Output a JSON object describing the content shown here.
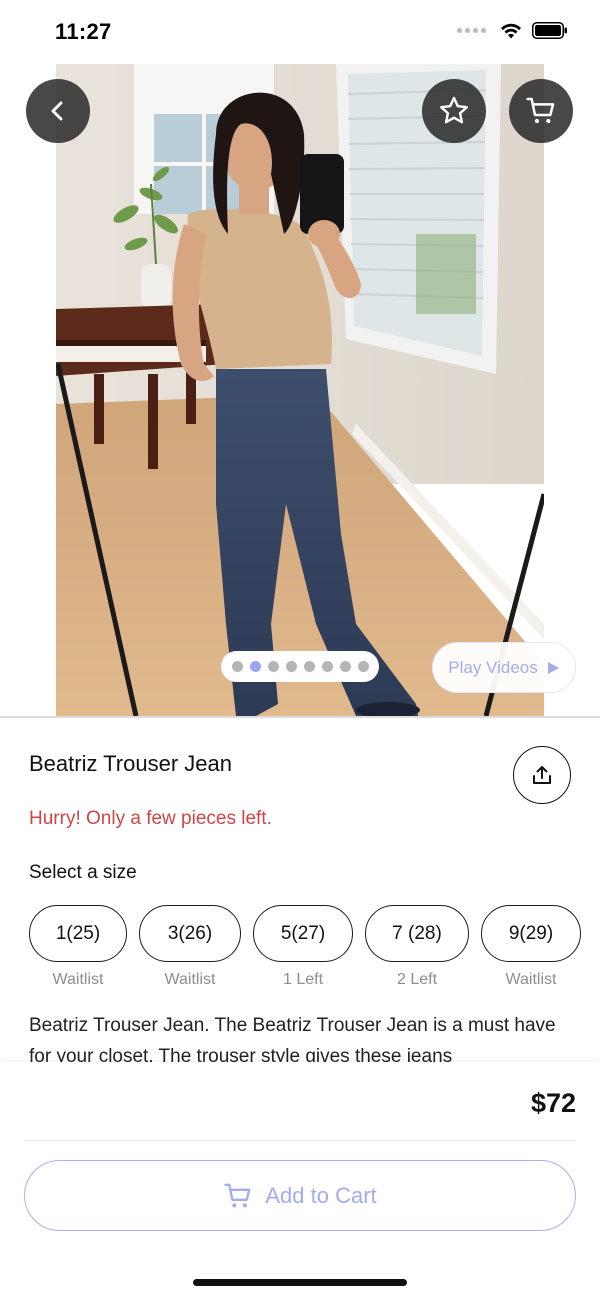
{
  "status_bar": {
    "time": "11:27"
  },
  "hero": {
    "pager_count": 8,
    "pager_active_index": 1,
    "play_videos_label": "Play Videos"
  },
  "product": {
    "title": "Beatriz Trouser Jean",
    "urgency": "Hurry! Only a few pieces left.",
    "select_size_label": "Select a size",
    "sizes": [
      {
        "label": "1(25)",
        "note": "Waitlist"
      },
      {
        "label": "3(26)",
        "note": "Waitlist"
      },
      {
        "label": "5(27)",
        "note": "1 Left"
      },
      {
        "label": "7 (28)",
        "note": "2 Left"
      },
      {
        "label": "9(29)",
        "note": "Waitlist"
      }
    ],
    "description": "Beatriz Trouser Jean. The Beatriz Trouser Jean is a must have for your closet. The trouser style gives these jeans"
  },
  "footer": {
    "price": "$72",
    "add_to_cart_label": "Add to Cart"
  },
  "colors": {
    "accent": "#a4acee",
    "urgency": "#d04545",
    "pager_active": "#9aa6ef"
  }
}
